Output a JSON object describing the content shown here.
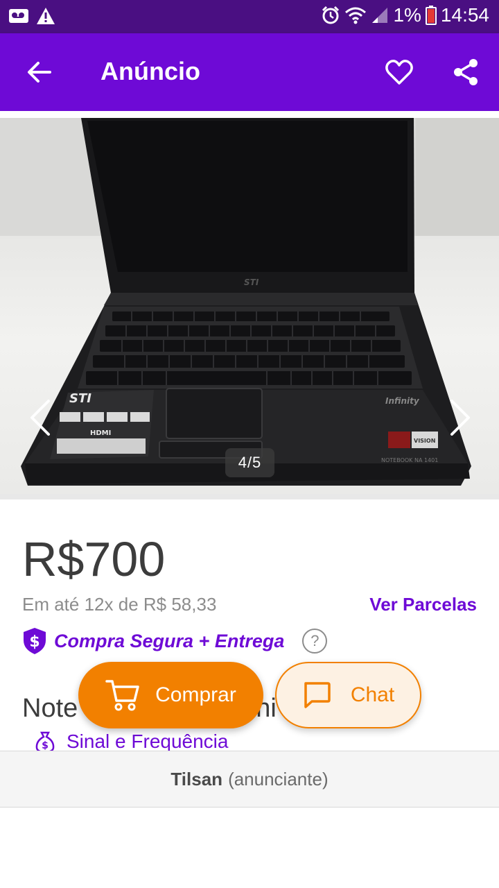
{
  "status_bar": {
    "battery": "1%",
    "time": "14:54",
    "icons": [
      "voicemail-icon",
      "warning-icon",
      "alarm-icon",
      "wifi-icon",
      "signal-icon",
      "battery-icon"
    ]
  },
  "app_bar": {
    "title": "Anúncio",
    "icons": [
      "back-arrow-icon",
      "heart-icon",
      "share-icon"
    ]
  },
  "gallery": {
    "counter": "4/5",
    "brand_on_lid": "STI",
    "sticker_brand": "STI",
    "sticker_hdmi": "HDMI",
    "palmrest_logo": "Infinity",
    "model_label": "NOTEBOOK NA 1401",
    "vision_badge": "VISION"
  },
  "listing": {
    "price": "R$700",
    "installments": "Em até 12x de R$ 58,33",
    "installments_link": "Ver Parcelas",
    "safe_purchase": "Compra Segura + Entrega",
    "help": "?",
    "title_visible": "Note",
    "title_tail": "shi",
    "subline": "Sinal e Frequência"
  },
  "actions": {
    "buy_label": "Comprar",
    "chat_label": "Chat"
  },
  "seller_bar": {
    "name": "Tilsan",
    "role": "(anunciante)"
  },
  "colors": {
    "status_bar": "#4a0f82",
    "app_bar": "#6e0ad6",
    "accent_purple": "#6e0ad6",
    "buy_orange": "#f28000",
    "chat_bg": "#fdf1e3"
  }
}
